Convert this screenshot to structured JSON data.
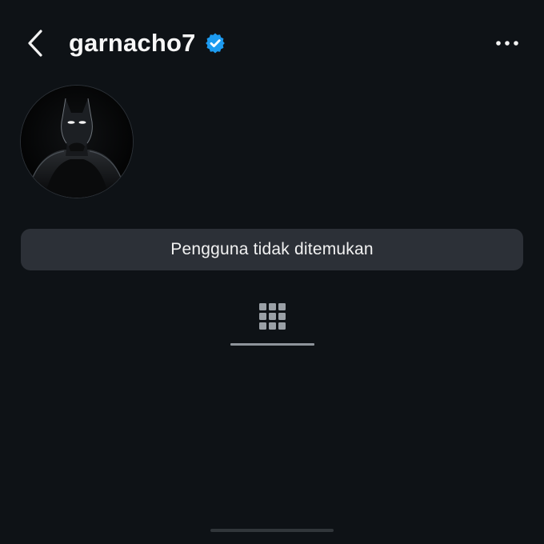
{
  "header": {
    "back_icon": "chevron-left-icon",
    "username": "garnacho7",
    "verified_icon": "verified-badge-icon",
    "more_icon": "ellipsis-horizontal-icon"
  },
  "profile": {
    "avatar_icon": "batman-avatar"
  },
  "status": {
    "message": "Pengguna tidak ditemukan"
  },
  "tabs": {
    "grid_icon": "grid-icon",
    "active_indicator": "tab-underline"
  },
  "colors": {
    "background": "#0e1216",
    "status_bar": "#2c3037",
    "verified_blue": "#1d9bf0",
    "text": "#f5f5f5",
    "muted": "#8e949b"
  }
}
